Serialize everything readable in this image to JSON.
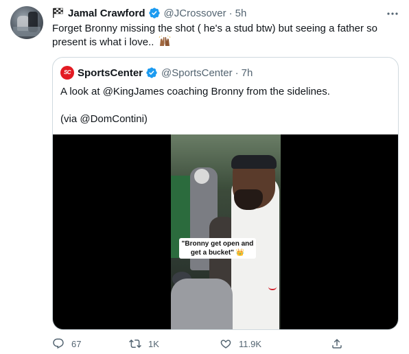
{
  "tweet": {
    "display_name": "Jamal Crawford",
    "handle": "@JCrossover",
    "separator": "·",
    "time": "5h",
    "text": "Forget Bronny missing the shot ( he's a stud btw) but seeing a father so present is what i love..",
    "emoji_icon": "raised-hands-icon"
  },
  "quoted_tweet": {
    "display_name": "SportsCenter",
    "logo_text": "SC",
    "handle": "@SportsCenter",
    "separator": "·",
    "time": "7h",
    "text_line1": "A look at @KingJames coaching Bronny from the sidelines.",
    "text_line2": "(via @DomContini)",
    "video_caption": "\"Bronny get open and get a bucket\" 👑"
  },
  "actions": {
    "replies": "67",
    "retweets": "1K",
    "likes": "11.9K"
  },
  "colors": {
    "verified": "#1d9bf0",
    "secondary_text": "#536471",
    "border": "#cfd9de",
    "sc_red": "#e31b23"
  }
}
